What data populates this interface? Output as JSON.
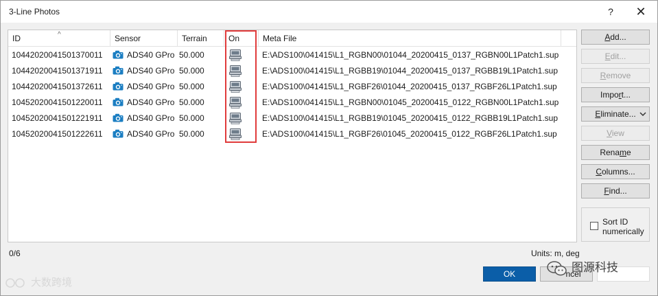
{
  "window": {
    "title": "3-Line Photos",
    "help_glyph": "?",
    "close_glyph": "✕"
  },
  "list": {
    "sort_indicator": "^",
    "columns": {
      "id": "ID",
      "sensor": "Sensor",
      "terrain": "Terrain",
      "on": "On",
      "meta": "Meta File"
    },
    "rows": [
      {
        "id": "10442020041501370011",
        "sensor": "ADS40 GPro",
        "terrain": "50.000",
        "on_icon": "on-status-icon",
        "meta": "E:\\ADS100\\041415\\L1_RGBN00\\01044_20200415_0137_RGBN00L1Patch1.sup"
      },
      {
        "id": "10442020041501371911",
        "sensor": "ADS40 GPro",
        "terrain": "50.000",
        "on_icon": "on-status-icon",
        "meta": "E:\\ADS100\\041415\\L1_RGBB19\\01044_20200415_0137_RGBB19L1Patch1.sup"
      },
      {
        "id": "10442020041501372611",
        "sensor": "ADS40 GPro",
        "terrain": "50.000",
        "on_icon": "on-status-icon",
        "meta": "E:\\ADS100\\041415\\L1_RGBF26\\01044_20200415_0137_RGBF26L1Patch1.sup"
      },
      {
        "id": "10452020041501220011",
        "sensor": "ADS40 GPro",
        "terrain": "50.000",
        "on_icon": "on-status-icon",
        "meta": "E:\\ADS100\\041415\\L1_RGBN00\\01045_20200415_0122_RGBN00L1Patch1.sup"
      },
      {
        "id": "10452020041501221911",
        "sensor": "ADS40 GPro",
        "terrain": "50.000",
        "on_icon": "on-status-icon",
        "meta": "E:\\ADS100\\041415\\L1_RGBB19\\01045_20200415_0122_RGBB19L1Patch1.sup"
      },
      {
        "id": "10452020041501222611",
        "sensor": "ADS40 GPro",
        "terrain": "50.000",
        "on_icon": "on-status-icon",
        "meta": "E:\\ADS100\\041415\\L1_RGBF26\\01045_20200415_0122_RGBF26L1Patch1.sup"
      }
    ]
  },
  "buttons": {
    "add": {
      "pre": "",
      "key": "A",
      "post": "dd..."
    },
    "edit": {
      "pre": "",
      "key": "E",
      "post": "dit..."
    },
    "remove": {
      "pre": "",
      "key": "R",
      "post": "emove"
    },
    "import": {
      "pre": "Impo",
      "key": "r",
      "post": "t..."
    },
    "eliminate": {
      "pre": "",
      "key": "E",
      "post": "liminate..."
    },
    "view": {
      "pre": "",
      "key": "V",
      "post": "iew"
    },
    "rename": {
      "pre": "Rena",
      "key": "m",
      "post": "e"
    },
    "columns": {
      "pre": "",
      "key": "C",
      "post": "olumns..."
    },
    "find": {
      "pre": "",
      "key": "F",
      "post": "ind..."
    }
  },
  "sort_option": {
    "label": "Sort ID numerically",
    "checked": false
  },
  "status": {
    "count": "0/6",
    "units": "Units: m, deg"
  },
  "footer": {
    "ok_label": "OK",
    "cancel_label": "ncel"
  },
  "watermarks": {
    "brand": "图源科技",
    "corner": "大数跨境"
  },
  "colors": {
    "highlight": "#e03a3a",
    "ok_button": "#0b5ea8",
    "camera": "#1b7ec2"
  }
}
